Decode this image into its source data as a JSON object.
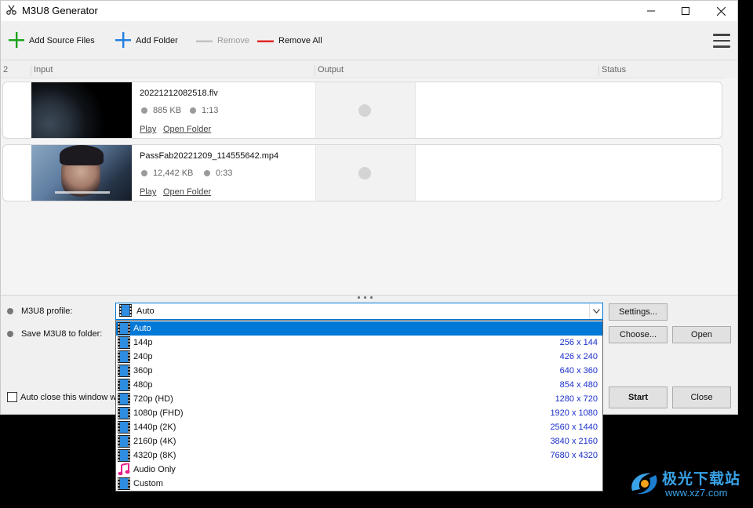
{
  "window": {
    "title": "M3U8 Generator",
    "controls": {
      "minimize": "minimize",
      "maximize": "maximize",
      "close": "close"
    }
  },
  "toolbar": {
    "add_source_files": "Add Source Files",
    "add_folder": "Add Folder",
    "remove": "Remove",
    "remove_all": "Remove All",
    "menu_icon": "hamburger-menu-icon"
  },
  "list": {
    "count": "2",
    "headers": {
      "input": "Input",
      "output": "Output",
      "status": "Status"
    },
    "files": [
      {
        "name": "20221212082518.flv",
        "size": "885 KB",
        "duration": "1:13",
        "play": "Play",
        "open_folder": "Open Folder"
      },
      {
        "name": "PassFab20221209_114555642.mp4",
        "size": "12,442 KB",
        "duration": "0:33",
        "play": "Play",
        "open_folder": "Open Folder"
      }
    ]
  },
  "settings": {
    "profile_label": "M3U8 profile:",
    "profile_value": "Auto",
    "folder_label": "Save M3U8 to folder:",
    "settings_button": "Settings...",
    "choose_button": "Choose...",
    "open_button": "Open",
    "auto_close_label": "Auto close this window wh",
    "start_button": "Start",
    "close_button": "Close"
  },
  "profile_options": [
    {
      "label": "Auto",
      "resolution": "",
      "icon": "film-icon",
      "selected": true
    },
    {
      "label": "144p",
      "resolution": "256 x 144",
      "icon": "film-icon"
    },
    {
      "label": "240p",
      "resolution": "426 x 240",
      "icon": "film-icon"
    },
    {
      "label": "360p",
      "resolution": "640 x 360",
      "icon": "film-icon"
    },
    {
      "label": "480p",
      "resolution": "854 x 480",
      "icon": "film-icon"
    },
    {
      "label": "720p (HD)",
      "resolution": "1280 x 720",
      "icon": "film-icon"
    },
    {
      "label": "1080p (FHD)",
      "resolution": "1920 x 1080",
      "icon": "film-icon"
    },
    {
      "label": "1440p (2K)",
      "resolution": "2560 x 1440",
      "icon": "film-icon"
    },
    {
      "label": "2160p (4K)",
      "resolution": "3840 x 2160",
      "icon": "film-icon"
    },
    {
      "label": "4320p (8K)",
      "resolution": "7680 x 4320",
      "icon": "film-icon"
    },
    {
      "label": "Audio Only",
      "resolution": "",
      "icon": "music-note-icon"
    },
    {
      "label": "Custom",
      "resolution": "",
      "icon": "film-icon"
    }
  ],
  "watermark": {
    "text_top": "极光下载站",
    "text_bottom": "www.xz7.com"
  },
  "colors": {
    "accent": "#0078d7",
    "add_green": "#1aa31a",
    "add_blue": "#1f7fe0",
    "remove_red": "#e02020",
    "resolution_text": "#1a2fc8"
  }
}
